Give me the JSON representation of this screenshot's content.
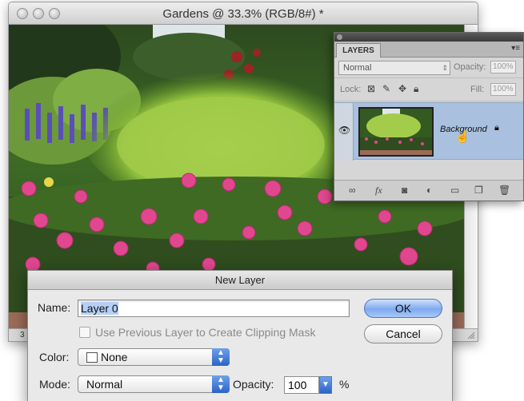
{
  "document_window": {
    "title": "Gardens @ 33.3% (RGB/8#) *",
    "status_zoom": "3"
  },
  "layers_panel": {
    "tab_label": "LAYERS",
    "menu_glyph": "▾≡",
    "blend_mode": "Normal",
    "opacity_label": "Opacity:",
    "opacity_value": "100%",
    "lock_label": "Lock:",
    "fill_label": "Fill:",
    "fill_value": "100%",
    "layer_name": "Background",
    "bottom_icons": [
      "link-icon",
      "fx-icon",
      "mask-icon",
      "adjustment-icon",
      "group-folder-icon",
      "new-layer-icon",
      "trash-icon"
    ]
  },
  "dialog": {
    "title": "New Layer",
    "name_label": "Name:",
    "name_value": "Layer 0",
    "clip_label": "Use Previous Layer to Create Clipping Mask",
    "color_label": "Color:",
    "color_value": "None",
    "mode_label": "Mode:",
    "mode_value": "Normal",
    "opacity_label": "Opacity:",
    "opacity_value": "100",
    "percent": "%",
    "ok_label": "OK",
    "cancel_label": "Cancel"
  }
}
